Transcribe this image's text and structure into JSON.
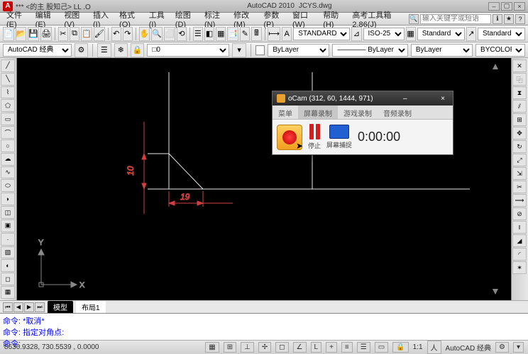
{
  "title": {
    "app": "AutoCAD 2010",
    "file": "JCYS.dwg",
    "prefix": "*** <的主 股知己>      LL .O"
  },
  "menu": {
    "items": [
      "文件(E)",
      "编辑(E)",
      "视图(V)",
      "插入(I)",
      "格式(O)",
      "工具(I)",
      "绘图(D)",
      "标注(N)",
      "修改(M)",
      "参数(P)",
      "窗口(W)",
      "帮助(H)",
      "高考工具箱2.86(J)"
    ],
    "search_ph": "输入关键字或短语"
  },
  "toolbar1": {
    "standard1": "STANDARD",
    "iso": "ISO-25",
    "standard2": "Standard",
    "standard3": "Standard"
  },
  "toolbar2": {
    "workspace": "AutoCAD 经典",
    "layer_state": "□0",
    "layer": "ByLayer",
    "line": "ByLayer",
    "bycolor": "BYCOLOR"
  },
  "drawing": {
    "dim1": "10",
    "dim2": "19",
    "axisX": "X",
    "axisY": "Y"
  },
  "tabs": {
    "model": "模型",
    "layout1": "布局1"
  },
  "cmd": {
    "l1": "命令: *取消*",
    "l2": "命令: 指定对角点:",
    "l3": "命令:"
  },
  "status": {
    "coords": "8636.9328, 730.5539 , 0.0000",
    "scale": "1:1",
    "workspace": "AutoCAD 经典"
  },
  "ocam": {
    "title": "oCam (312, 60, 1444, 971)",
    "tabs": [
      "菜单",
      "屏幕录制",
      "游戏录制",
      "音频录制"
    ],
    "stop": "停止",
    "capture": "屏幕捕捉",
    "time": "0:00:00"
  }
}
